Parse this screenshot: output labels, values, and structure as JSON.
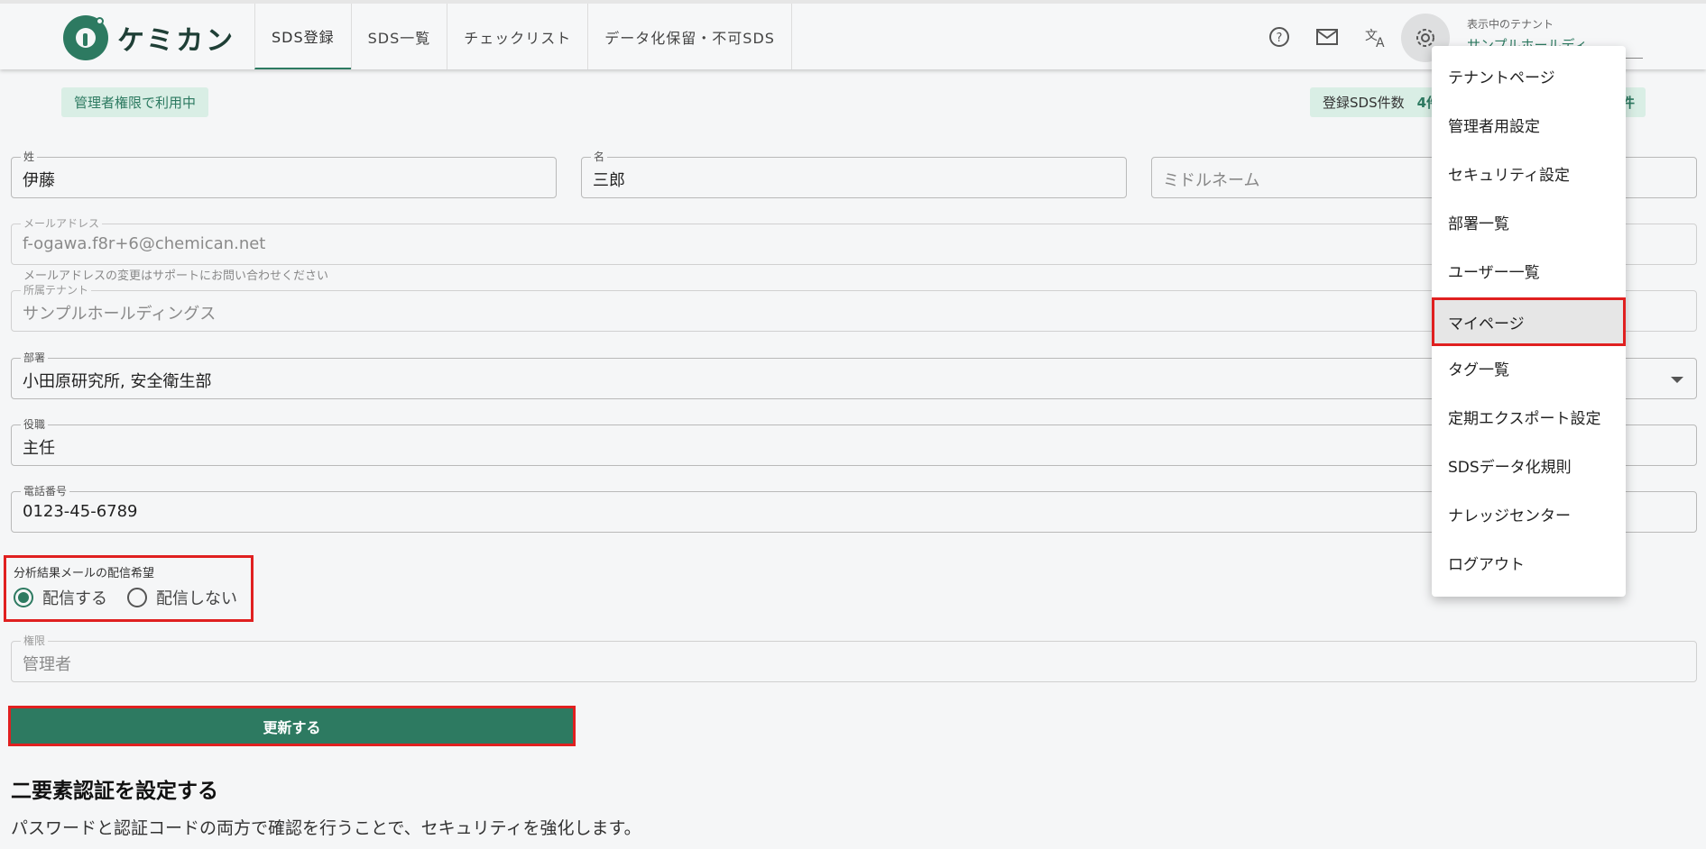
{
  "header": {
    "logo_text": "ケミカン",
    "tabs": [
      {
        "label": "SDS登録",
        "active": true
      },
      {
        "label": "SDS一覧",
        "active": false
      },
      {
        "label": "チェックリスト",
        "active": false
      },
      {
        "label": "データ化保留・不可SDS",
        "active": false
      }
    ],
    "icons": [
      "help-icon",
      "mail-icon",
      "translate-icon",
      "gear-icon"
    ],
    "tenant_label": "表示中のテナント",
    "tenant_value": "サンプルホールディ"
  },
  "badges": {
    "admin": "管理者権限で利用中",
    "count_label": "登録SDS件数",
    "count_value": "4件",
    "count_unit": "件"
  },
  "form": {
    "last_name": {
      "label": "姓",
      "value": "伊藤"
    },
    "first_name": {
      "label": "名",
      "value": "三郎"
    },
    "middle_name": {
      "placeholder": "ミドルネーム"
    },
    "email": {
      "label": "メールアドレス",
      "value": "f-ogawa.f8r+6@chemican.net",
      "helper": "メールアドレスの変更はサポートにお問い合わせください"
    },
    "tenant": {
      "label": "所属テナント",
      "value": "サンプルホールディングス"
    },
    "department": {
      "label": "部署",
      "value": "小田原研究所, 安全衛生部"
    },
    "position": {
      "label": "役職",
      "value": "主任"
    },
    "phone": {
      "label": "電話番号",
      "value": "0123-45-6789"
    },
    "mail_pref": {
      "title": "分析結果メールの配信希望",
      "options": [
        "配信する",
        "配信しない"
      ],
      "selected": "配信する"
    },
    "role": {
      "label": "権限",
      "value": "管理者"
    },
    "update_button": "更新する"
  },
  "twofa": {
    "title": "二要素認証を設定する",
    "description": "パスワードと認証コードの両方で確認を行うことで、セキュリティを強化します。"
  },
  "menu": {
    "items": [
      "テナントページ",
      "管理者用設定",
      "セキュリティ設定",
      "部署一覧",
      "ユーザー一覧",
      "マイページ",
      "タグ一覧",
      "定期エクスポート設定",
      "SDSデータ化規則",
      "ナレッジセンター",
      "ログアウト"
    ],
    "highlighted": "マイページ"
  },
  "colors": {
    "accent": "#2d7a61",
    "highlight_border": "#e02020",
    "badge_bg": "#d9eee5"
  }
}
